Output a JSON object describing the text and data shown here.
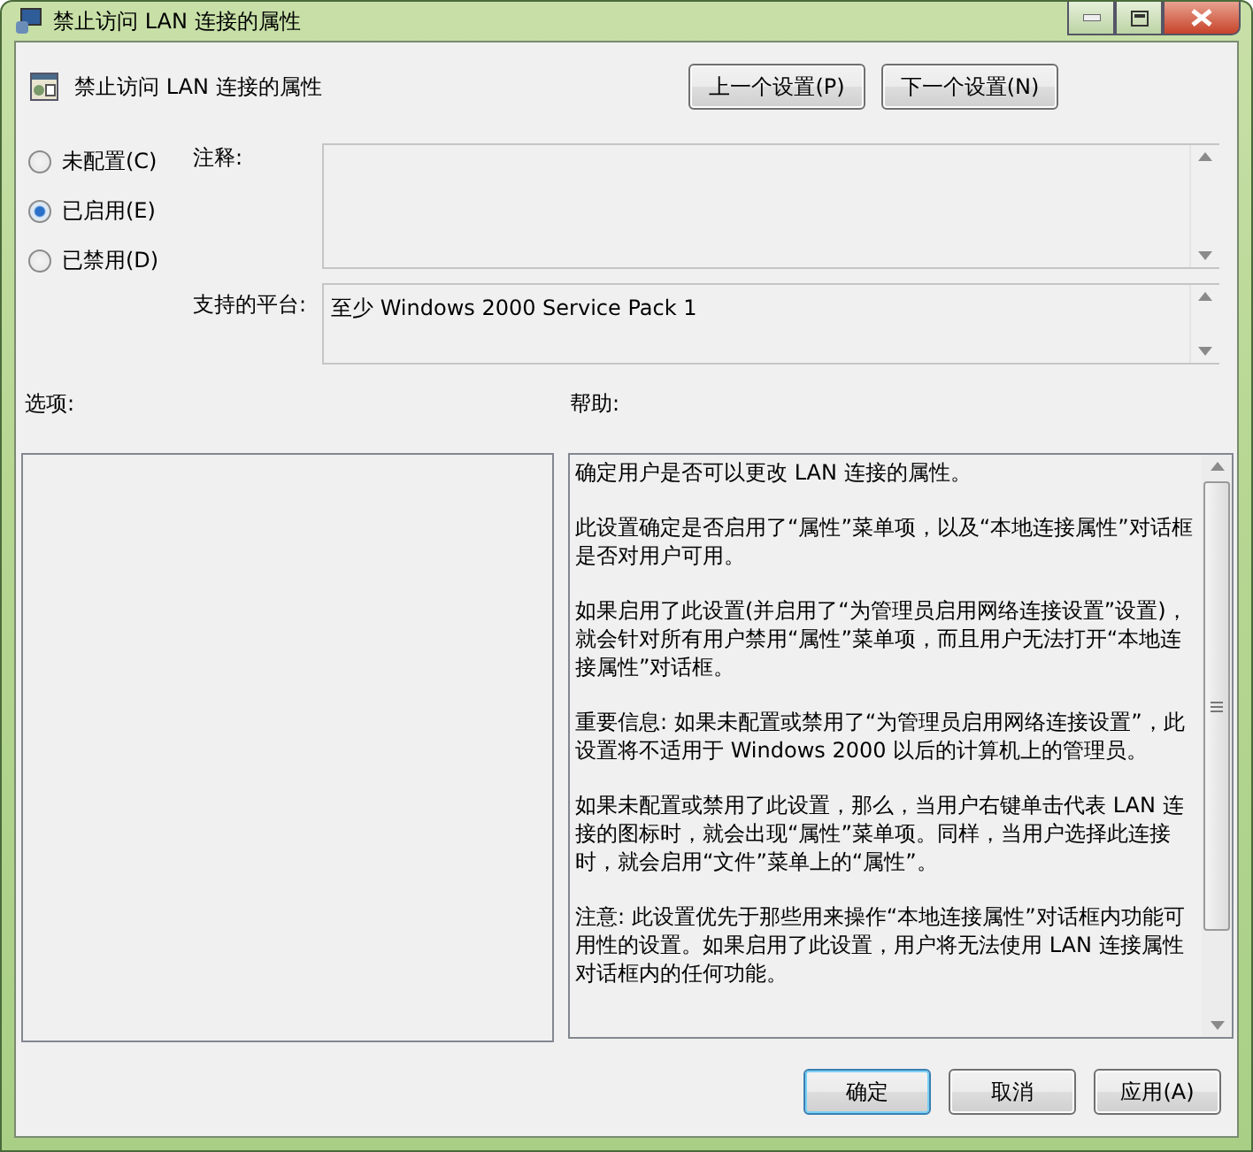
{
  "window": {
    "title": "禁止访问 LAN 连接的属性"
  },
  "header": {
    "title": "禁止访问 LAN 连接的属性"
  },
  "nav_buttons": [
    "上一个设置(P)",
    "下一个设置(N)"
  ],
  "radios": [
    {
      "label": "未配置(C)",
      "selected": false
    },
    {
      "label": "已启用(E)",
      "selected": true
    },
    {
      "label": "已禁用(D)",
      "selected": false
    }
  ],
  "comment": {
    "label": "注释:"
  },
  "platform": {
    "label": "支持的平台:",
    "value": "至少 Windows 2000 Service Pack 1"
  },
  "options": {
    "label": "选项:"
  },
  "help": {
    "label": "帮助:",
    "paragraphs": [
      "确定用户是否可以更改 LAN 连接的属性。",
      "此设置确定是否启用了“属性”菜单项，以及“本地连接属性”对话框是否对用户可用。",
      "如果启用了此设置(并启用了“为管理员启用网络连接设置”设置)，就会针对所有用户禁用“属性”菜单项，而且用户无法打开“本地连接属性”对话框。",
      "重要信息: 如果未配置或禁用了“为管理员启用网络连接设置”，此设置将不适用于 Windows 2000 以后的计算机上的管理员。",
      "如果未配置或禁用了此设置，那么，当用户右键单击代表 LAN 连接的图标时，就会出现“属性”菜单项。同样，当用户选择此连接时，就会启用“文件”菜单上的“属性”。",
      "注意: 此设置优先于那些用来操作“本地连接属性”对话框内功能可用性的设置。如果启用了此设置，用户将无法使用 LAN 连接属性对话框内的任何功能。"
    ]
  },
  "buttons": [
    {
      "label": "确定",
      "selected": true
    },
    {
      "label": "取消",
      "selected": false
    },
    {
      "label": "应用(A)",
      "selected": false
    }
  ]
}
